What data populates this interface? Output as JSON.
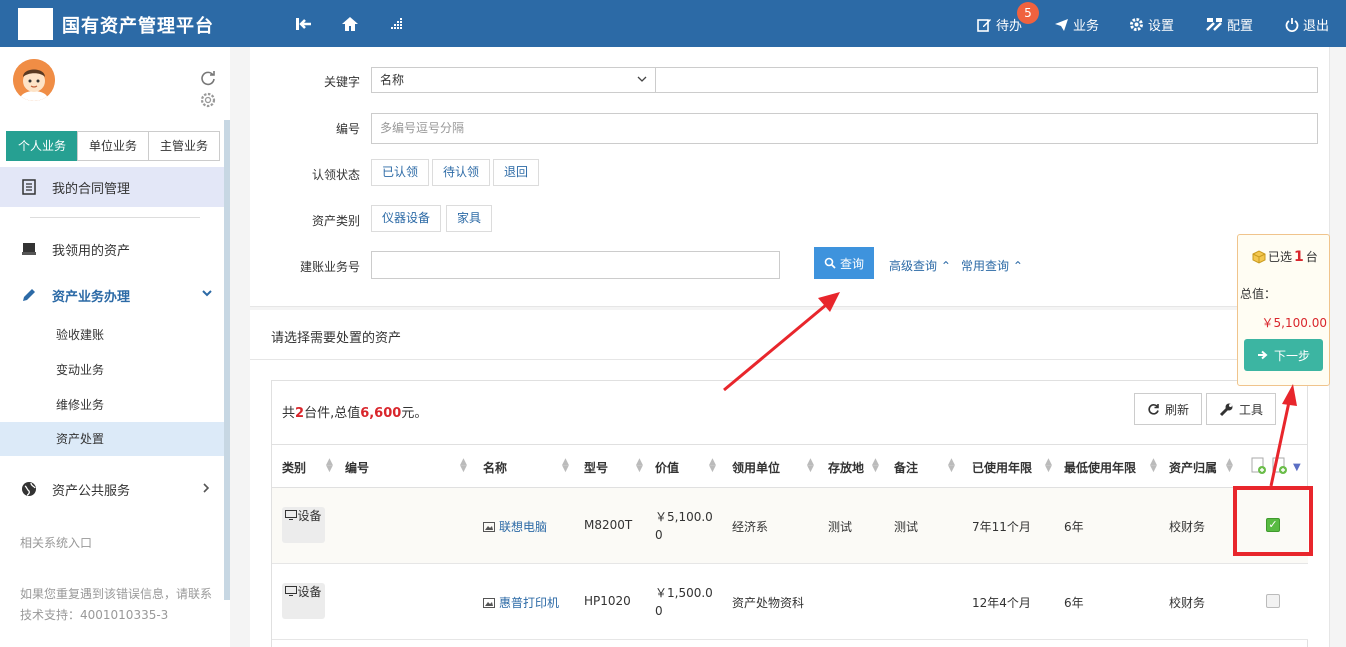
{
  "app": {
    "title": "国有资产管理平台"
  },
  "topnav": {
    "badge_count": "5",
    "todo": "待办",
    "business": "业务",
    "settings": "设置",
    "config": "配置",
    "logout": "退出"
  },
  "sidebar": {
    "tabs": [
      "个人业务",
      "单位业务",
      "主管业务"
    ],
    "items": {
      "contract": "我的合同管理",
      "my_assets": "我领用的资产",
      "asset_business": "资产业务办理",
      "public_service": "资产公共服务"
    },
    "subitems": [
      "验收建账",
      "变动业务",
      "维修业务",
      "资产处置"
    ],
    "related_entry": "相关系统入口",
    "help_text": "如果您重复遇到该错误信息，请联系技术支持：4001010335-3"
  },
  "search": {
    "keyword_label": "关键字",
    "keyword_select": "名称",
    "number_label": "编号",
    "number_placeholder": "多编号逗号分隔",
    "status_label": "认领状态",
    "status_options": [
      "已认领",
      "待认领",
      "退回"
    ],
    "category_label": "资产类别",
    "category_options": [
      "仪器设备",
      "家具"
    ],
    "account_label": "建账业务号",
    "query_button": "查询",
    "advanced_link": "高级查询",
    "common_link": "常用查询"
  },
  "list": {
    "title": "请选择需要处置的资产",
    "summary_prefix": "共",
    "summary_count": "2",
    "summary_mid": "台件,总值",
    "summary_total": "6,600",
    "summary_suffix": "元。",
    "refresh_button": "刷新",
    "tools_button": "工具",
    "columns": [
      "类别",
      "编号",
      "名称",
      "型号",
      "价值",
      "领用单位",
      "存放地",
      "备注",
      "已使用年限",
      "最低使用年限",
      "资产归属"
    ],
    "rows": [
      {
        "type": "设备",
        "number": "",
        "name": "联想电脑",
        "model": "M8200T",
        "value": "￥5,100.00",
        "unit": "经济系",
        "location": "测试",
        "remark": "测试",
        "used_years": "7年11个月",
        "min_years": "6年",
        "owner": "校财务",
        "checked": true
      },
      {
        "type": "设备",
        "number": "",
        "name": "惠普打印机",
        "model": "HP1020",
        "value": "￥1,500.00",
        "unit": "资产处物资科",
        "location": "",
        "remark": "",
        "used_years": "12年4个月",
        "min_years": "6年",
        "owner": "校财务",
        "checked": false
      }
    ]
  },
  "selection": {
    "prefix": "已选",
    "count": "1",
    "suffix": "台",
    "total_label": "总值：",
    "total_value": "￥5,100.00",
    "next_button": "下一步"
  }
}
